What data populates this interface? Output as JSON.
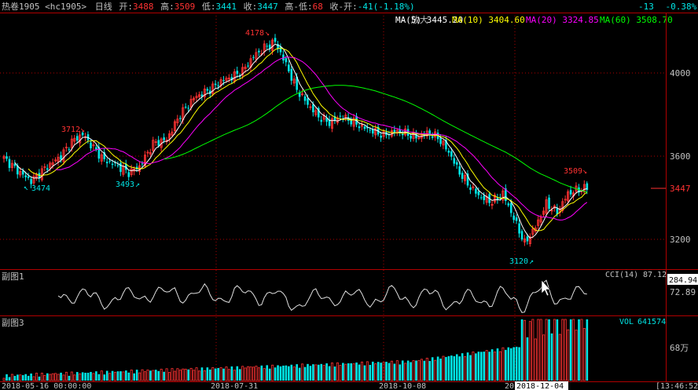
{
  "colors": {
    "up": "#ff3232",
    "down": "#00e5e5",
    "ma5": "#ffffff",
    "ma10": "#ffff00",
    "ma20": "#ff00ff",
    "ma60": "#00ff00",
    "grid": "#b00000",
    "text": "#c0c0c0",
    "bg": "#000000"
  },
  "header": {
    "instrument": "热卷1905 <hc1905>",
    "period": "日线",
    "open_label": "开:",
    "open": "3488",
    "high_label": "高:",
    "high": "3509",
    "low_label": "低:",
    "low": "3441",
    "close_label": "收:",
    "close": "3447",
    "range_label": "高-低:",
    "range": "68",
    "change_label": "收-开:",
    "change": "-41(-1.18%)",
    "tail_change": "-13",
    "tail_pct": "-0.38%",
    "zoom_label": "-- 放大"
  },
  "ma_legend": [
    {
      "label": "MA(5)",
      "value": "3445.20",
      "color": "#ffffff"
    },
    {
      "label": "MA(10)",
      "value": "3404.60",
      "color": "#ffff00"
    },
    {
      "label": "MA(20)",
      "value": "3324.85",
      "color": "#ff00ff"
    },
    {
      "label": "MA(60)",
      "value": "3508.70",
      "color": "#00ff00"
    }
  ],
  "price_axis": {
    "ticks": [
      "4000",
      "3600",
      "3200"
    ],
    "current": "3447"
  },
  "price_annotations": [
    "4178",
    "3712",
    "3474",
    "3493",
    "3509",
    "3120"
  ],
  "sub1": {
    "title": "副图1",
    "indicator": "CCI(14)",
    "value": "87.12",
    "axis_top": "284.94",
    "axis_mid": "72.89"
  },
  "sub3": {
    "title": "副图3",
    "indicator": "VOL",
    "value": "641574",
    "axis_mid": "68万"
  },
  "date_axis": {
    "labels": [
      "2018-05-16 00:00:00",
      "2018-07-31",
      "2018-10-08",
      "20",
      "2018-12-04"
    ],
    "time": "[13:46:52"
  },
  "chart_data": {
    "type": "candlestick",
    "ylim": [
      3050,
      4260
    ],
    "grid": true,
    "series": [
      "MA(5)",
      "MA(10)",
      "MA(20)",
      "MA(60)"
    ]
  }
}
